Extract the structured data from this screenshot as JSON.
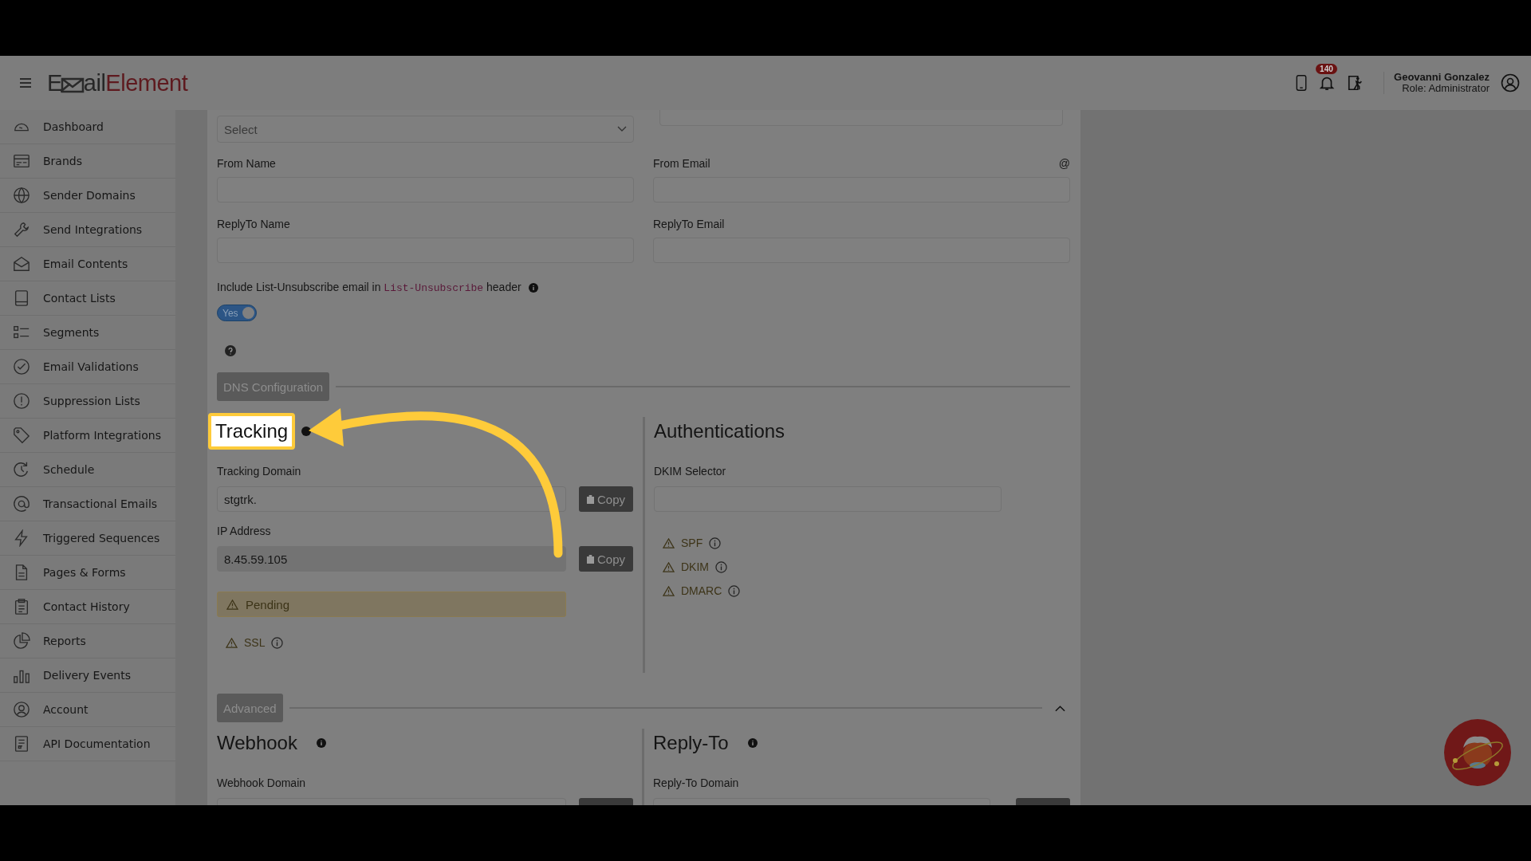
{
  "header": {
    "logo": {
      "lead": "E",
      "rest": "ail",
      "accent": "Element"
    },
    "badge": "140",
    "user": {
      "name": "Geovanni Gonzalez",
      "role": "Role: Administrator"
    }
  },
  "sidebar": {
    "items": [
      {
        "label": "Dashboard"
      },
      {
        "label": "Brands"
      },
      {
        "label": "Sender Domains"
      },
      {
        "label": "Send Integrations"
      },
      {
        "label": "Email Contents"
      },
      {
        "label": "Contact Lists"
      },
      {
        "label": "Segments"
      },
      {
        "label": "Email Validations"
      },
      {
        "label": "Suppression Lists"
      },
      {
        "label": "Platform Integrations"
      },
      {
        "label": "Schedule"
      },
      {
        "label": "Transactional Emails"
      },
      {
        "label": "Triggered Sequences"
      },
      {
        "label": "Pages & Forms"
      },
      {
        "label": "Contact History"
      },
      {
        "label": "Reports"
      },
      {
        "label": "Delivery Events"
      },
      {
        "label": "Account"
      },
      {
        "label": "API Documentation"
      }
    ]
  },
  "form": {
    "select": {
      "placeholder": "Select"
    },
    "fields": [
      {
        "label": "From Name"
      },
      {
        "label": "From Email",
        "suffix": "@"
      },
      {
        "label": "ReplyTo Name"
      },
      {
        "label": "ReplyTo Email"
      }
    ],
    "unsubscribe": {
      "before": "Include List-Unsubscribe email in",
      "code": "List-Unsubscribe",
      "after": "header"
    },
    "toggle": {
      "label": "Yes",
      "on": true
    }
  },
  "dns": {
    "button": "DNS Configuration",
    "tracking": {
      "title": "Tracking",
      "highlighted": true,
      "fields": [
        {
          "label": "Tracking Domain",
          "value": "stgtrk.",
          "readonly": false,
          "button": "Copy"
        },
        {
          "label": "IP Address",
          "value": "8.45.59.105",
          "readonly": true,
          "button": "Copy"
        }
      ],
      "status": "Pending",
      "checks": [
        {
          "label": "SSL"
        }
      ]
    },
    "auth": {
      "title": "Authentications",
      "field": "DKIM Selector",
      "checks": [
        {
          "label": "SPF"
        },
        {
          "label": "DKIM"
        },
        {
          "label": "DMARC"
        }
      ]
    }
  },
  "advanced": {
    "button": "Advanced",
    "expanded": true,
    "webhook": {
      "title": "Webhook",
      "field": "Webhook Domain"
    },
    "reply_to": {
      "title": "Reply-To",
      "field": "Reply-To Domain"
    }
  }
}
